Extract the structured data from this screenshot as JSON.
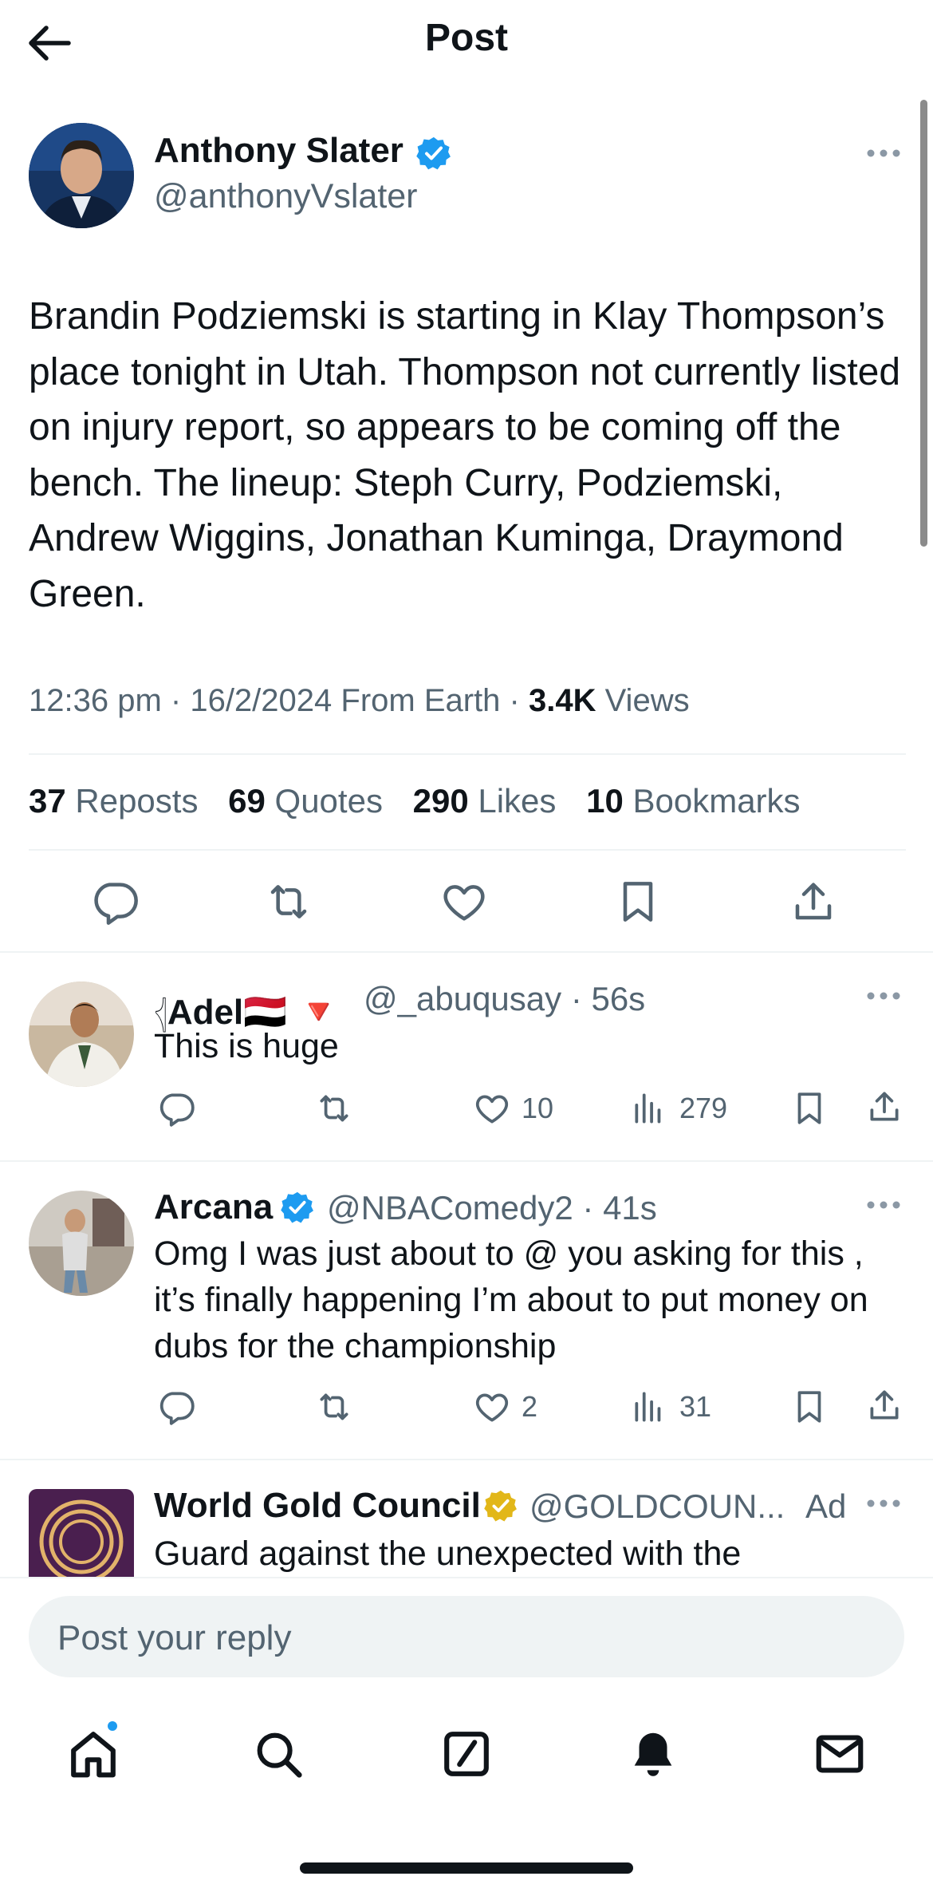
{
  "header": {
    "title": "Post"
  },
  "main_post": {
    "name": "Anthony Slater",
    "handle": "@anthonyVslater",
    "text": "Brandin Podziemski is starting in Klay Thompson’s place tonight in Utah. Thompson not currently listed on injury report, so appears to be coming off the bench. The lineup: Steph Curry, Podziemski, Andrew Wiggins, Jonathan Kuminga, Draymond Green.",
    "time": "12:36 pm · 16/2/2024 From Earth · ",
    "views_count": "3.4K",
    "views_label": " Views",
    "stats": {
      "reposts_count": "37",
      "reposts_label": " Reposts",
      "quotes_count": "69",
      "quotes_label": " Quotes",
      "likes_count": "290",
      "likes_label": " Likes",
      "bookmarks_count": "10",
      "bookmarks_label": " Bookmarks"
    }
  },
  "replies": [
    {
      "prefix": "𓂆",
      "name": "Adel🇾🇪 🔻",
      "handle": "@_abuqusay · 56s",
      "text": "This is huge",
      "likes": "10",
      "views": "279"
    },
    {
      "name": "Arcana",
      "handle": "@NBAComedy2 · 41s",
      "text": "Omg I was just about to @ you asking for this , it’s finally happening I’m about to put money on dubs for the championship",
      "likes": "2",
      "views": "31"
    },
    {
      "name": "World Gold Council",
      "handle": "@GOLDCOUN...",
      "ad_label": "Ad",
      "text": "Guard against the unexpected with the"
    }
  ],
  "reply_box": {
    "placeholder": "Post your reply"
  },
  "colors": {
    "accent": "#1d9bf0",
    "secondary_text": "#536471",
    "gold_badge": "#e2b719",
    "divider": "#eff3f4"
  },
  "icons": [
    "back-arrow-icon",
    "verified-badge-icon",
    "more-icon",
    "reply-icon",
    "repost-icon",
    "like-icon",
    "bookmark-icon",
    "share-icon",
    "views-icon",
    "home-icon",
    "search-icon",
    "compose-icon",
    "bell-icon",
    "mail-icon"
  ]
}
